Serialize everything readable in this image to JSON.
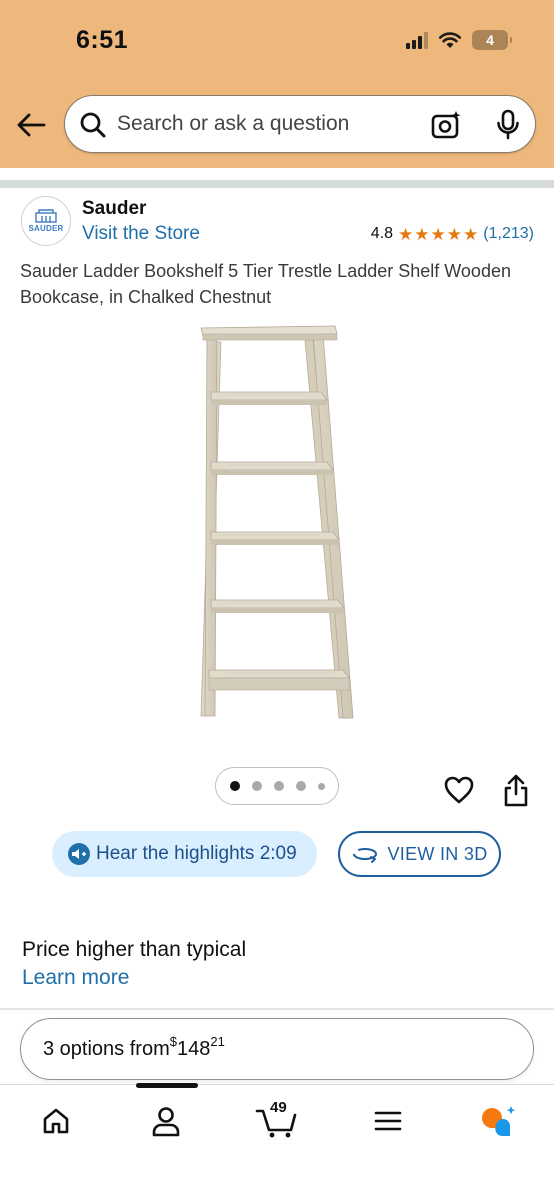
{
  "status_bar": {
    "time": "6:51",
    "battery": "4"
  },
  "search": {
    "placeholder": "Search or ask a question"
  },
  "brand": {
    "logo_text": "SAUDER",
    "name": "Sauder",
    "store_link": "Visit the Store"
  },
  "rating": {
    "value": "4.8",
    "stars": 5,
    "count": "(1,213)"
  },
  "product": {
    "title": "Sauder Ladder Bookshelf 5 Tier Trestle Ladder Shelf Wooden Bookcase, in Chalked Chestnut"
  },
  "carousel": {
    "total": 5,
    "active": 1
  },
  "actions": {
    "highlights_label": "Hear the highlights 2:09",
    "view3d_label": "VIEW IN 3D"
  },
  "price_info": {
    "note": "Price higher than typical",
    "learn_more": "Learn more"
  },
  "options": {
    "prefix": "3 options from ",
    "currency": "$",
    "whole": "148",
    "fraction": "21"
  },
  "nav": {
    "cart_count": "49"
  },
  "colors": {
    "header": "#eeb77b",
    "link": "#1f6fa8",
    "star": "#e47911"
  }
}
